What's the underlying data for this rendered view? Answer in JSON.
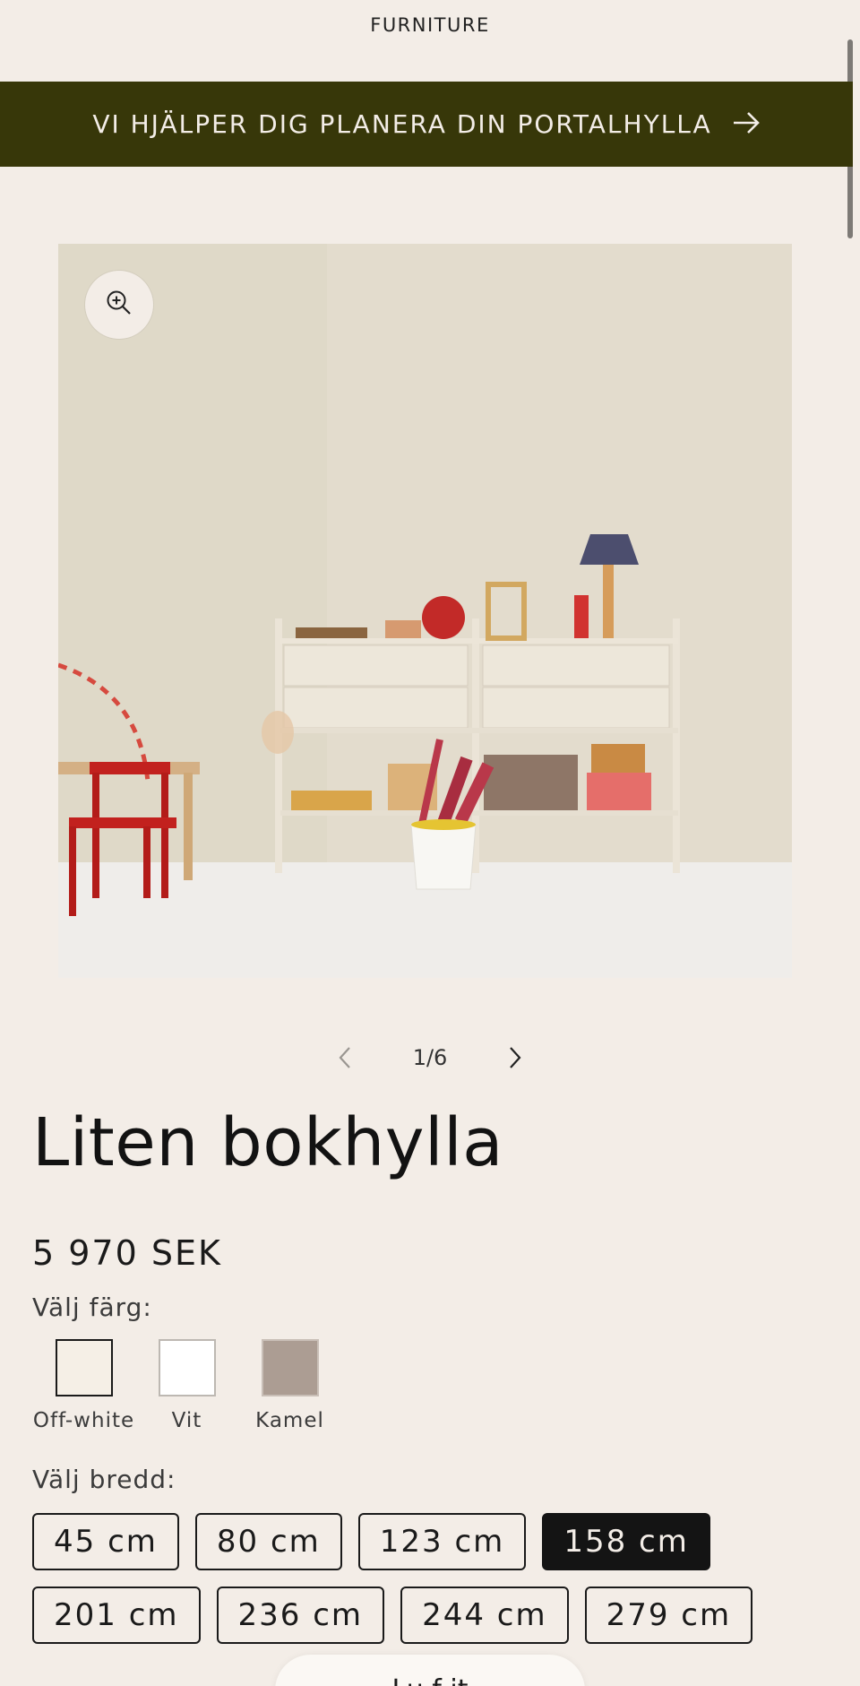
{
  "header": {
    "logo": "FURNITURE"
  },
  "banner": {
    "text": "VI HJÄLPER DIG PLANERA DIN PORTALHYLLA",
    "arrow_icon": "arrow-right-icon",
    "background": "#373709"
  },
  "gallery": {
    "zoom_icon": "zoom-in-icon",
    "counter": "1/6"
  },
  "product": {
    "title": "Liten bokhylla",
    "price": "5 970 SEK",
    "color_label": "Välj färg:",
    "colors": [
      {
        "name": "Off-white",
        "hex": "#f5efe6",
        "selected": true
      },
      {
        "name": "Vit",
        "hex": "#ffffff",
        "selected": false
      },
      {
        "name": "Kamel",
        "hex": "#ac9d93",
        "selected": false
      }
    ],
    "width_label": "Välj bredd:",
    "widths": [
      "45 cm",
      "80 cm",
      "123 cm",
      "158 cm",
      "201 cm",
      "236 cm",
      "244 cm",
      "279 cm"
    ],
    "selected_width": "158 cm"
  },
  "floating": {
    "label": "Lu f it"
  }
}
